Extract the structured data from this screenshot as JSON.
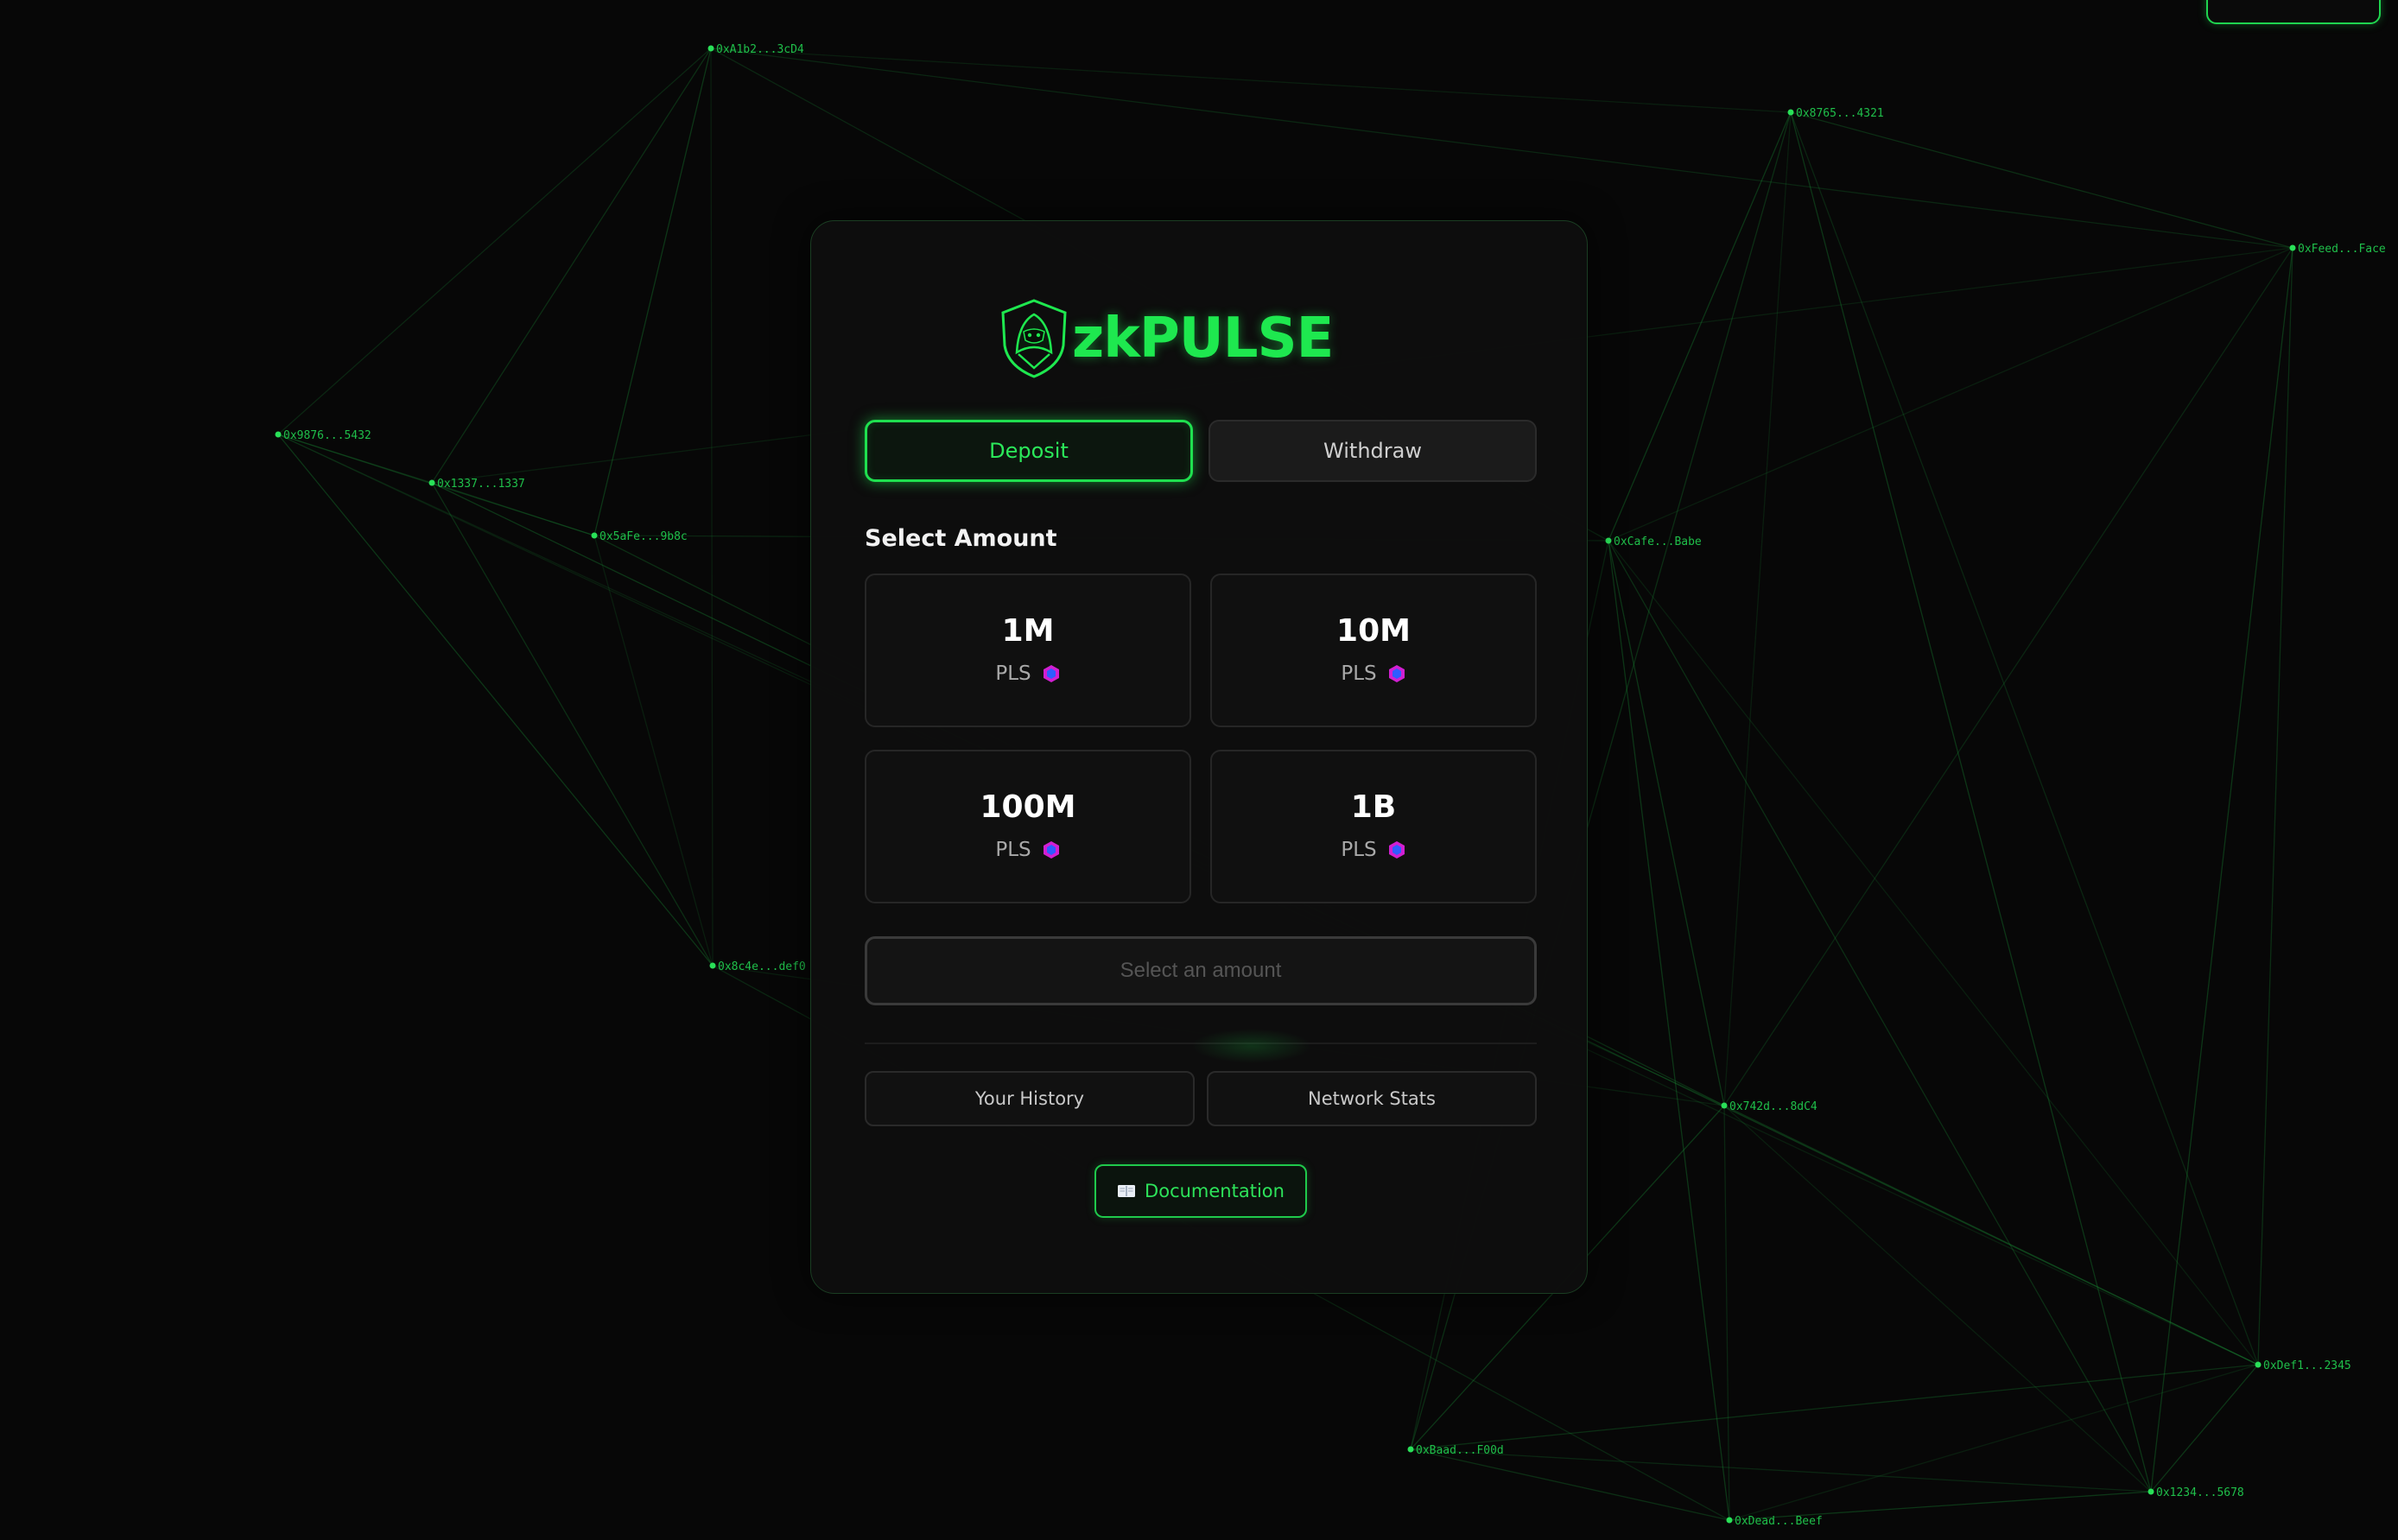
{
  "brand": {
    "name": "zkPULSE",
    "logo_icon": "hooded-shield-icon",
    "accent": "#1ee84f"
  },
  "tabs": [
    {
      "label": "Deposit",
      "active": true
    },
    {
      "label": "Withdraw",
      "active": false
    }
  ],
  "amount_section": {
    "title": "Select Amount",
    "options": [
      {
        "value": "1M",
        "unit": "PLS",
        "icon": "pulsechain-icon"
      },
      {
        "value": "10M",
        "unit": "PLS",
        "icon": "pulsechain-icon"
      },
      {
        "value": "100M",
        "unit": "PLS",
        "icon": "pulsechain-icon"
      },
      {
        "value": "1B",
        "unit": "PLS",
        "icon": "pulsechain-icon"
      }
    ]
  },
  "submit_button": {
    "label": "Select an amount",
    "disabled": true
  },
  "links": {
    "history": "Your History",
    "stats": "Network Stats"
  },
  "documentation": {
    "label": "Documentation",
    "icon": "book-icon"
  },
  "network_nodes": [
    {
      "label": "0xA1b2...3cD4"
    },
    {
      "label": "0x8765...4321"
    },
    {
      "label": "0xFeed...Face"
    },
    {
      "label": "0x9876...5432"
    },
    {
      "label": "0x1337...1337"
    },
    {
      "label": "0x5aFe...9b8c"
    },
    {
      "label": "0xCafe...Babe"
    },
    {
      "label": "0x8c4e...def0"
    },
    {
      "label": "0x742d...8dC4"
    },
    {
      "label": "0xDef1...2345"
    },
    {
      "label": "0xBaad...F00d"
    },
    {
      "label": "0x1234...5678"
    },
    {
      "label": "0xDead...Beef"
    }
  ]
}
